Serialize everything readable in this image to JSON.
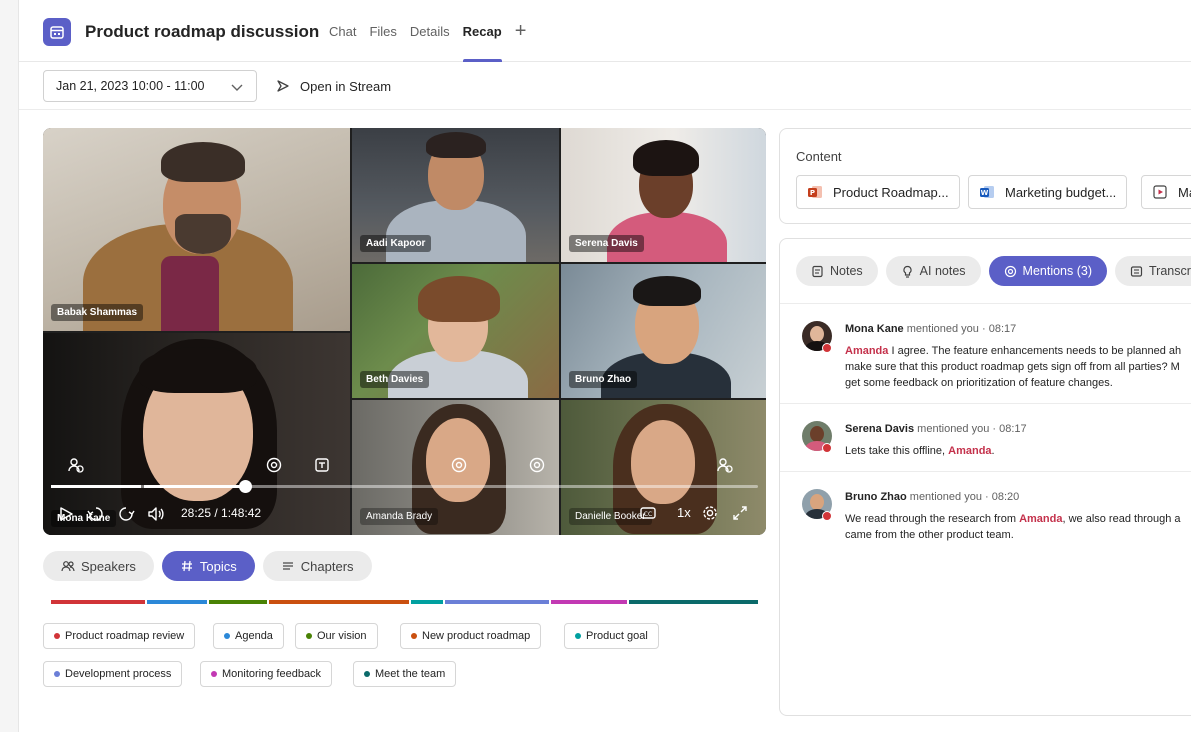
{
  "header": {
    "title": "Product roadmap discussion",
    "tabs": [
      {
        "label": "Chat"
      },
      {
        "label": "Files"
      },
      {
        "label": "Details"
      },
      {
        "label": "Recap"
      }
    ],
    "add_tab": "+"
  },
  "toolbar": {
    "date_range": "Jan 21, 2023 10:00 - 11:00",
    "open_in_stream": "Open in Stream"
  },
  "video": {
    "participants": [
      {
        "name": "Babak Shammas"
      },
      {
        "name": "Aadi Kapoor"
      },
      {
        "name": "Serena Davis"
      },
      {
        "name": "Beth Davies"
      },
      {
        "name": "Bruno Zhao"
      },
      {
        "name": "Mona Kane"
      },
      {
        "name": "Amanda Brady"
      },
      {
        "name": "Danielle Booker"
      }
    ],
    "time": "28:25 / 1:48:42",
    "speed": "1x",
    "progress": 0.26
  },
  "filters": [
    {
      "label": "Speakers",
      "icon": "people-icon"
    },
    {
      "label": "Topics",
      "icon": "hash-icon"
    },
    {
      "label": "Chapters",
      "icon": "list-icon"
    }
  ],
  "timeline_colors": [
    "#d13438",
    "#2b88d8",
    "#498205",
    "#ca5010",
    "#00a0a0",
    "#6b7fd7",
    "#c239b3",
    "#0b6a6a"
  ],
  "topics": [
    {
      "label": "Product roadmap review",
      "color": "#d13438"
    },
    {
      "label": "Agenda",
      "color": "#2b88d8"
    },
    {
      "label": "Our vision",
      "color": "#498205"
    },
    {
      "label": "New product roadmap",
      "color": "#ca5010"
    },
    {
      "label": "Product goal",
      "color": "#00a0a0"
    },
    {
      "label": "Development process",
      "color": "#6b7fd7"
    },
    {
      "label": "Monitoring feedback",
      "color": "#c239b3"
    },
    {
      "label": "Meet the team",
      "color": "#0b6a6a"
    }
  ],
  "content": {
    "label": "Content",
    "files": [
      {
        "label": "Product Roadmap...",
        "icon": "powerpoint-icon"
      },
      {
        "label": "Marketing budget...",
        "icon": "word-icon"
      },
      {
        "label": "Ma",
        "icon": "video-file-icon"
      }
    ]
  },
  "notes_tabs": [
    {
      "label": "Notes",
      "icon": "notes-icon"
    },
    {
      "label": "AI notes",
      "icon": "ai-notes-icon"
    },
    {
      "label": "Mentions (3)",
      "icon": "at-icon"
    },
    {
      "label": "Transcr",
      "icon": "transcript-icon"
    }
  ],
  "mentions": [
    {
      "name": "Mona Kane",
      "action": "mentioned you",
      "time": "08:17",
      "mention": "Amanda",
      "line1_rest": " I agree. The feature enhancements needs to be planned ah",
      "line2": "make sure that this product roadmap gets sign off from all parties? M",
      "line3": "get some  feedback on prioritization of feature changes."
    },
    {
      "name": "Serena Davis",
      "action": "mentioned you",
      "time": "08:17",
      "pre": "Lets take this offline, ",
      "mention": "Amanda",
      "post": "."
    },
    {
      "name": "Bruno Zhao",
      "action": "mentioned you",
      "time": "08:20",
      "pre": "We read through the research from ",
      "mention": "Amanda",
      "post": ", we also read through a",
      "line2": "came from the other product team."
    }
  ]
}
